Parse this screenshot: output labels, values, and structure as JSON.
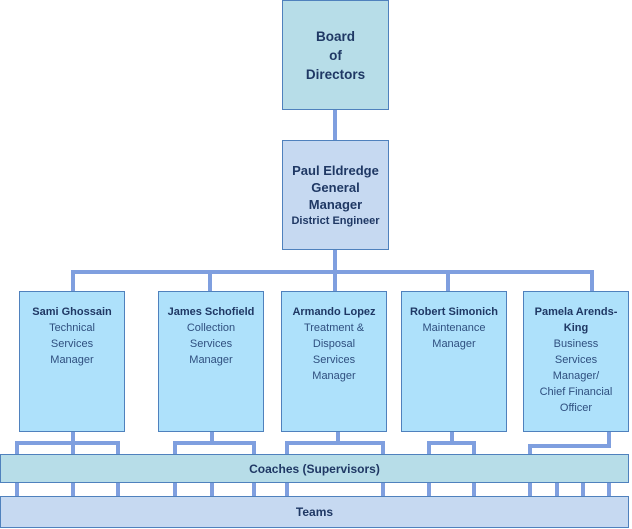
{
  "board": {
    "lines": [
      "Board",
      "of",
      "Directors"
    ]
  },
  "general_manager": {
    "name": "Paul Eldredge",
    "title_lines": [
      "General",
      "Manager"
    ],
    "subtitle": "District Engineer"
  },
  "managers": [
    {
      "name": "Sami Ghossain",
      "role_lines": [
        "Technical",
        "Services",
        "Manager"
      ]
    },
    {
      "name": "James Schofield",
      "role_lines": [
        "Collection",
        "Services",
        "Manager"
      ]
    },
    {
      "name": "Armando Lopez",
      "role_lines": [
        "Treatment &",
        "Disposal",
        "Services",
        "Manager"
      ]
    },
    {
      "name": "Robert Simonich",
      "role_lines": [
        "Maintenance",
        "Manager"
      ]
    },
    {
      "name_lines": [
        "Pamela Arends-",
        "King"
      ],
      "role_lines": [
        "Business",
        "Services",
        "Manager/",
        "Chief Financial",
        "Officer"
      ]
    }
  ],
  "coaches": {
    "label": "Coaches (Supervisors)"
  },
  "teams": {
    "label": "Teams"
  },
  "colors": {
    "connector": "#7f9fdf",
    "border": "#4f81bd",
    "board_fill": "#b7dde8",
    "gm_fill": "#c6d9f1",
    "manager_fill": "#aee1fb",
    "coaches_fill": "#b7dde8",
    "teams_fill": "#c6d9f1",
    "text_dark": "#1f3864"
  }
}
